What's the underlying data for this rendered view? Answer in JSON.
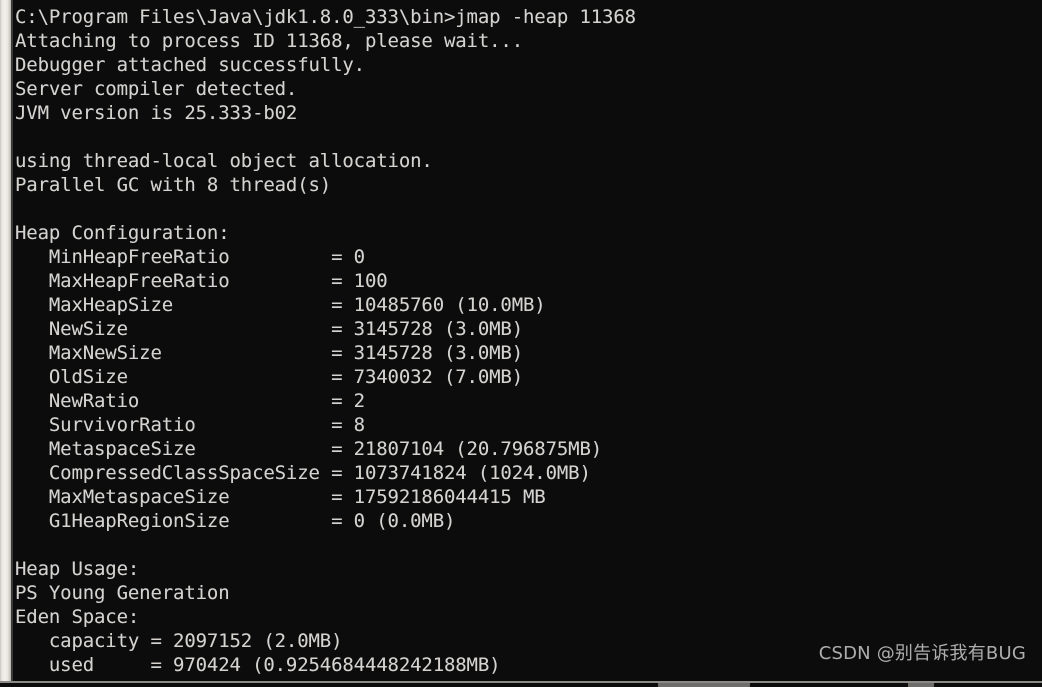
{
  "window": {
    "kind": "windows-command-prompt",
    "background_color": "#0c0c0c",
    "text_color": "#d6d3ce",
    "scrollbar_color": "#eceae4"
  },
  "console": {
    "prompt_path": "C:\\Program Files\\Java\\jdk1.8.0_333\\bin>",
    "command": "jmap -heap 11368",
    "lines": [
      "C:\\Program Files\\Java\\jdk1.8.0_333\\bin>jmap -heap 11368",
      "Attaching to process ID 11368, please wait...",
      "Debugger attached successfully.",
      "Server compiler detected.",
      "JVM version is 25.333-b02",
      "",
      "using thread-local object allocation.",
      "Parallel GC with 8 thread(s)",
      "",
      "Heap Configuration:",
      "   MinHeapFreeRatio         = 0",
      "   MaxHeapFreeRatio         = 100",
      "   MaxHeapSize              = 10485760 (10.0MB)",
      "   NewSize                  = 3145728 (3.0MB)",
      "   MaxNewSize               = 3145728 (3.0MB)",
      "   OldSize                  = 7340032 (7.0MB)",
      "   NewRatio                 = 2",
      "   SurvivorRatio            = 8",
      "   MetaspaceSize            = 21807104 (20.796875MB)",
      "   CompressedClassSpaceSize = 1073741824 (1024.0MB)",
      "   MaxMetaspaceSize         = 17592186044415 MB",
      "   G1HeapRegionSize         = 0 (0.0MB)",
      "",
      "Heap Usage:",
      "PS Young Generation",
      "Eden Space:",
      "   capacity = 2097152 (2.0MB)",
      "   used     = 970424 (0.9254684448242188MB)"
    ]
  },
  "heap_configuration": {
    "section_title": "Heap Configuration:",
    "entries": [
      {
        "name": "MinHeapFreeRatio",
        "value": "0"
      },
      {
        "name": "MaxHeapFreeRatio",
        "value": "100"
      },
      {
        "name": "MaxHeapSize",
        "value": "10485760 (10.0MB)"
      },
      {
        "name": "NewSize",
        "value": "3145728 (3.0MB)"
      },
      {
        "name": "MaxNewSize",
        "value": "3145728 (3.0MB)"
      },
      {
        "name": "OldSize",
        "value": "7340032 (7.0MB)"
      },
      {
        "name": "NewRatio",
        "value": "2"
      },
      {
        "name": "SurvivorRatio",
        "value": "8"
      },
      {
        "name": "MetaspaceSize",
        "value": "21807104 (20.796875MB)"
      },
      {
        "name": "CompressedClassSpaceSize",
        "value": "1073741824 (1024.0MB)"
      },
      {
        "name": "MaxMetaspaceSize",
        "value": "17592186044415 MB"
      },
      {
        "name": "G1HeapRegionSize",
        "value": "0 (0.0MB)"
      }
    ]
  },
  "heap_usage": {
    "section_title": "Heap Usage:",
    "generation": "PS Young Generation",
    "space": "Eden Space:",
    "entries": [
      {
        "name": "capacity",
        "value": "2097152 (2.0MB)"
      },
      {
        "name": "used",
        "value": "970424 (0.9254684448242188MB)"
      }
    ]
  },
  "jvm_info": {
    "attach_message": "Attaching to process ID 11368, please wait...",
    "debugger_message": "Debugger attached successfully.",
    "compiler_message": "Server compiler detected.",
    "version_message": "JVM version is 25.333-b02",
    "tlab_message": "using thread-local object allocation.",
    "gc_message": "Parallel GC with 8 thread(s)",
    "process_id": "11368",
    "jvm_version": "25.333-b02",
    "gc_threads": "8"
  },
  "watermark": {
    "text": "CSDN @别告诉我有BUG"
  }
}
